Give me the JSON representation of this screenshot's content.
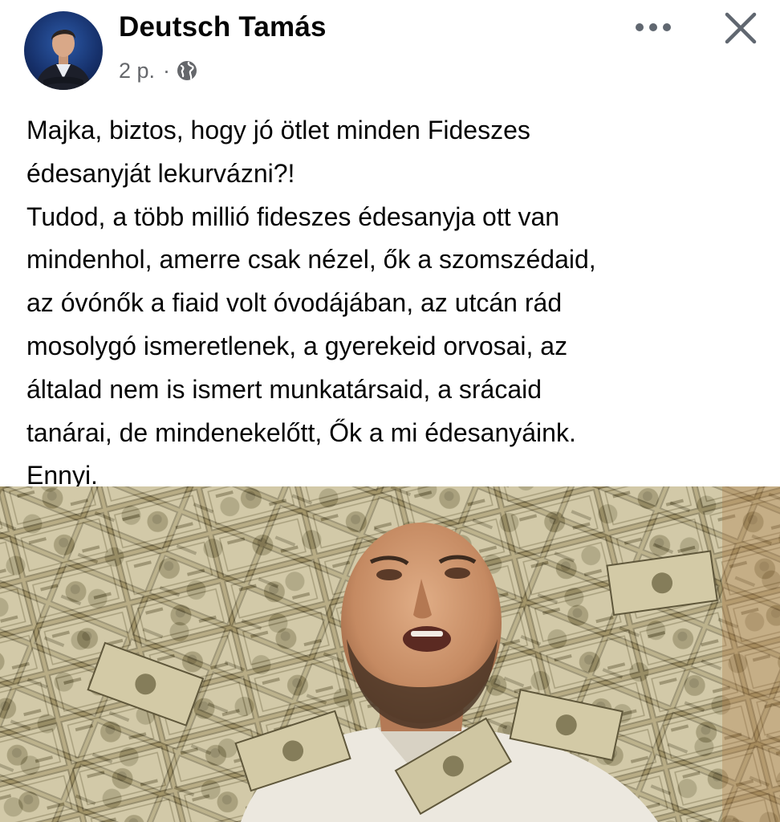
{
  "post": {
    "author": "Deutsch Tamás",
    "time": "2 p.",
    "separator": "·",
    "audience_icon": "globe-icon",
    "more_icon": "more-horizontal-icon",
    "close_icon": "close-icon",
    "text": "Majka, biztos, hogy jó ötlet minden Fideszes\nédesanyját lekurvázni?!\nTudod, a több millió fideszes édesanyja ott van\nmindenhol, amerre csak nézel, ők a szomszédaid,\naz óvónők a fiaid volt óvodájában, az utcán rád\nmosolygó ismeretlenek, a gyerekeid orvosai, az\náltalad nem is ismert munkatársaid, a srácaid\ntanárai, de mindenekelőtt, Ők a mi édesanyáink.\nEnnyi."
  },
  "colors": {
    "text": "#050505",
    "secondary_text": "#65676b",
    "icon": "#606770"
  }
}
